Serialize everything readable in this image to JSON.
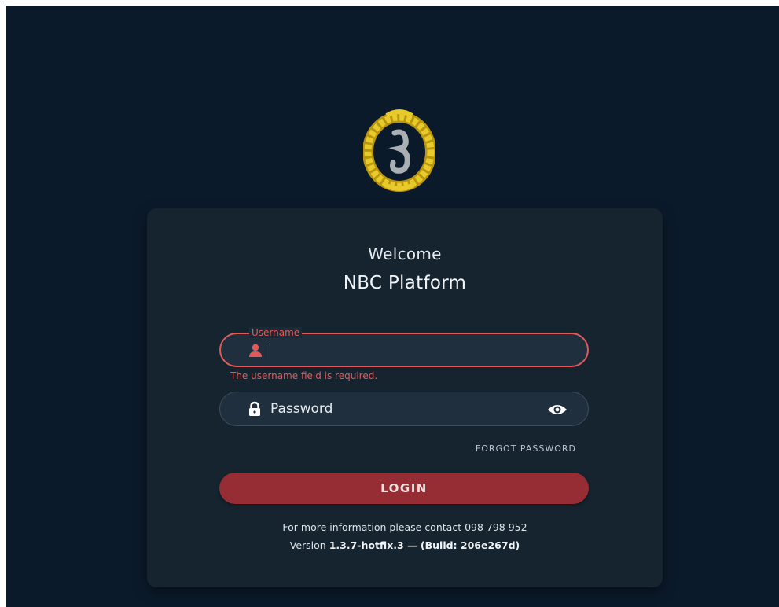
{
  "header": {
    "welcome": "Welcome",
    "platform": "NBC Platform"
  },
  "username": {
    "label": "Username",
    "value": "",
    "error": "The username field is required.",
    "icon": "user-icon"
  },
  "password": {
    "placeholder": "Password",
    "icon": "lock-icon",
    "toggle_icon": "eye-icon"
  },
  "actions": {
    "forgot": "FORGOT PASSWORD",
    "login": "LOGIN"
  },
  "footer": {
    "contact": "For more information please contact 098 798 952",
    "version_prefix": "Version",
    "version_value": "1.3.7-hotfix.3 — (Build: 206e267d)"
  },
  "colors": {
    "background": "#0b1a2b",
    "card": "#16242f",
    "error": "#e05a5a",
    "login_button": "#962d34",
    "logo_gold": "#d4b21a"
  }
}
